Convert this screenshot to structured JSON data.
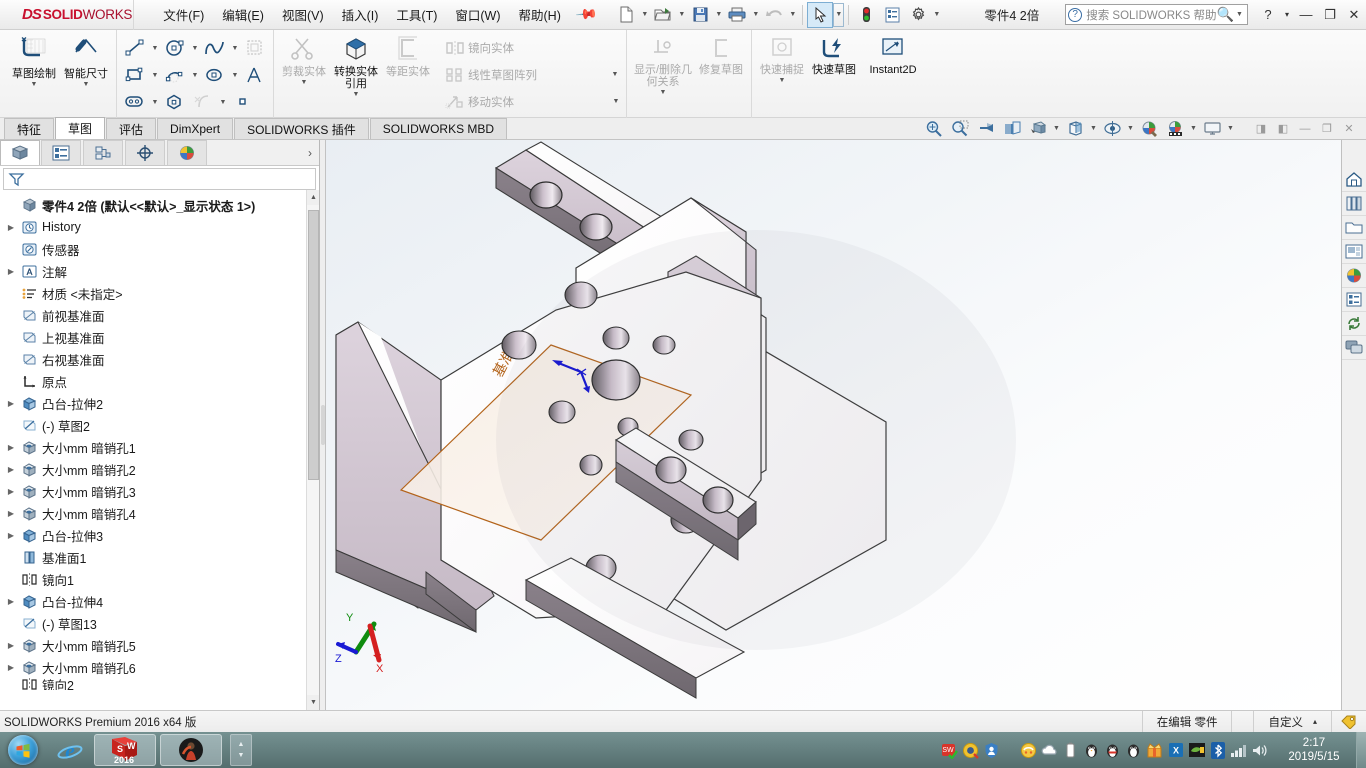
{
  "app": {
    "brand_ds": "DS",
    "brand_solid": "SOLID",
    "brand_works": "WORKS",
    "document_title": "零件4 2倍",
    "pin_icon": "pushpin-icon"
  },
  "menubar": {
    "items": [
      {
        "label": "文件(F)",
        "name": "menu-file"
      },
      {
        "label": "编辑(E)",
        "name": "menu-edit"
      },
      {
        "label": "视图(V)",
        "name": "menu-view"
      },
      {
        "label": "插入(I)",
        "name": "menu-insert"
      },
      {
        "label": "工具(T)",
        "name": "menu-tools"
      },
      {
        "label": "窗口(W)",
        "name": "menu-window"
      },
      {
        "label": "帮助(H)",
        "name": "menu-help"
      }
    ]
  },
  "quick_toolbar": {
    "buttons": [
      {
        "name": "new-document-icon",
        "has_dropdown": true
      },
      {
        "name": "open-document-icon",
        "has_dropdown": true
      },
      {
        "name": "save-icon",
        "has_dropdown": true
      },
      {
        "name": "print-icon",
        "has_dropdown": true
      },
      {
        "name": "undo-icon",
        "has_dropdown": true
      },
      {
        "name": "select-cursor-icon",
        "has_dropdown": true,
        "selected": true
      },
      {
        "name": "rebuild-icon",
        "has_dropdown": false
      },
      {
        "name": "file-properties-icon",
        "has_dropdown": false
      },
      {
        "name": "options-gear-icon",
        "has_dropdown": true
      }
    ]
  },
  "search": {
    "placeholder": "搜索 SOLIDWORKS 帮助",
    "help_icon": "question-circle-icon",
    "magnifier_icon": "search-icon"
  },
  "window_buttons": {
    "help": "?",
    "help_dropdown": "▾",
    "minimize": "—",
    "restore": "❐",
    "close": "✕"
  },
  "ribbon": {
    "group1": [
      {
        "label": "草图绘制",
        "name": "sketch-button",
        "icon": "sketch-pencil-icon",
        "enabled": true,
        "dropdown": true
      },
      {
        "label": "智能尺寸",
        "name": "smart-dimension-button",
        "icon": "smart-dimension-icon",
        "enabled": true,
        "dropdown": true
      }
    ],
    "group2_icons": [
      {
        "name": "line-tool-icon",
        "dropdown": true
      },
      {
        "name": "circle-tool-icon",
        "dropdown": true
      },
      {
        "name": "spline-tool-icon",
        "dropdown": true
      },
      {
        "name": "trim-entities-grid-icon",
        "dropdown": false
      },
      {
        "name": "rectangle-tool-icon",
        "dropdown": true
      },
      {
        "name": "arc-tool-icon",
        "dropdown": true
      },
      {
        "name": "ellipse-tool-icon",
        "dropdown": true
      },
      {
        "name": "text-tool-icon",
        "dropdown": false
      },
      {
        "name": "slot-tool-icon",
        "dropdown": true
      },
      {
        "name": "polygon-tool-icon",
        "dropdown": false
      },
      {
        "name": "fillet-tool-icon",
        "dropdown": true
      },
      {
        "name": "point-tool-icon",
        "dropdown": false
      }
    ],
    "group3": [
      {
        "label": "剪裁实体",
        "name": "trim-entities-button",
        "icon": "trim-scissors-icon",
        "enabled": false,
        "dropdown": true
      },
      {
        "label": "转换实体引用",
        "name": "convert-entities-button",
        "icon": "convert-entities-icon",
        "enabled": true,
        "dropdown": true
      },
      {
        "label": "等距实体",
        "name": "offset-entities-button",
        "icon": "offset-entities-icon",
        "enabled": false,
        "dropdown": false
      }
    ],
    "group4_rows": [
      {
        "label": "镜向实体",
        "name": "mirror-entities-button",
        "icon": "mirror-entities-icon",
        "enabled": false,
        "dropdown": false
      },
      {
        "label": "线性草图阵列",
        "name": "linear-sketch-pattern-button",
        "icon": "linear-pattern-icon",
        "enabled": false,
        "dropdown": true
      },
      {
        "label": "移动实体",
        "name": "move-entities-button",
        "icon": "move-entities-icon",
        "enabled": false,
        "dropdown": true
      }
    ],
    "group5": [
      {
        "label": "显示/删除几何关系",
        "name": "display-delete-relations-button",
        "icon": "relations-icon",
        "enabled": false,
        "dropdown": true
      },
      {
        "label": "修复草图",
        "name": "repair-sketch-button",
        "icon": "repair-sketch-icon",
        "enabled": false,
        "dropdown": false
      }
    ],
    "group6": [
      {
        "label": "快速捕捉",
        "name": "quick-snaps-button",
        "icon": "quick-snap-icon",
        "enabled": false,
        "dropdown": true
      },
      {
        "label": "快速草图",
        "name": "rapid-sketch-button",
        "icon": "rapid-sketch-icon",
        "enabled": true,
        "dropdown": false
      },
      {
        "label": "Instant2D",
        "name": "instant2d-button",
        "icon": "instant2d-icon",
        "enabled": true,
        "dropdown": false
      }
    ]
  },
  "tabs": {
    "items": [
      {
        "label": "特征",
        "name": "tab-features",
        "active": false
      },
      {
        "label": "草图",
        "name": "tab-sketch",
        "active": true
      },
      {
        "label": "评估",
        "name": "tab-evaluate",
        "active": false
      },
      {
        "label": "DimXpert",
        "name": "tab-dimxpert",
        "active": false
      },
      {
        "label": "SOLIDWORKS 插件",
        "name": "tab-solidworks-addins",
        "active": false
      },
      {
        "label": "SOLIDWORKS MBD",
        "name": "tab-solidworks-mbd",
        "active": false
      }
    ]
  },
  "view_toolbar": {
    "buttons": [
      {
        "name": "zoom-to-fit-icon",
        "dropdown": false
      },
      {
        "name": "zoom-to-area-icon",
        "dropdown": false
      },
      {
        "name": "previous-view-icon",
        "dropdown": false
      },
      {
        "name": "section-view-icon",
        "dropdown": false
      },
      {
        "name": "view-orientation-icon",
        "dropdown": false
      },
      {
        "name": "display-style-icon",
        "dropdown": true
      },
      {
        "name": "hide-show-items-icon",
        "dropdown": true
      },
      {
        "name": "edit-appearance-icon",
        "dropdown": true
      },
      {
        "name": "apply-scene-icon",
        "dropdown": true
      },
      {
        "name": "view-settings-icon",
        "dropdown": true
      }
    ],
    "window_controls": [
      {
        "name": "tile-left-icon",
        "glyph": "◨"
      },
      {
        "name": "tile-right-icon",
        "glyph": "◧"
      },
      {
        "name": "minimize-doc-icon",
        "glyph": "—"
      },
      {
        "name": "restore-doc-icon",
        "glyph": "❐"
      },
      {
        "name": "close-doc-icon",
        "glyph": "✕"
      }
    ]
  },
  "manager_tabs": [
    {
      "name": "feature-manager-tab",
      "icon": "feature-tree-icon",
      "active": true
    },
    {
      "name": "property-manager-tab",
      "icon": "property-list-icon",
      "active": false
    },
    {
      "name": "configuration-manager-tab",
      "icon": "configuration-icon",
      "active": false
    },
    {
      "name": "dimxpert-manager-tab",
      "icon": "dimxpert-target-icon",
      "active": false
    },
    {
      "name": "display-manager-tab",
      "icon": "display-sphere-icon",
      "active": false
    }
  ],
  "feature_tree": {
    "filter_icon": "filter-funnel-icon",
    "root": {
      "label": "零件4 2倍  (默认<<默认>_显示状态 1>)",
      "icon": "part-icon",
      "name": "tree-root"
    },
    "items": [
      {
        "label": "History",
        "icon": "history-icon",
        "arrow": true,
        "name": "tree-item-history"
      },
      {
        "label": "传感器",
        "icon": "sensor-icon",
        "arrow": false,
        "name": "tree-item-sensors"
      },
      {
        "label": "注解",
        "icon": "annotations-icon",
        "arrow": true,
        "name": "tree-item-annotations"
      },
      {
        "label": "材质 <未指定>",
        "icon": "material-icon",
        "arrow": false,
        "name": "tree-item-material"
      },
      {
        "label": "前视基准面",
        "icon": "plane-icon",
        "arrow": false,
        "name": "tree-item-front-plane"
      },
      {
        "label": "上视基准面",
        "icon": "plane-icon",
        "arrow": false,
        "name": "tree-item-top-plane"
      },
      {
        "label": "右视基准面",
        "icon": "plane-icon",
        "arrow": false,
        "name": "tree-item-right-plane"
      },
      {
        "label": "原点",
        "icon": "origin-icon",
        "arrow": false,
        "name": "tree-item-origin"
      },
      {
        "label": "凸台-拉伸2",
        "icon": "extrude-icon",
        "arrow": true,
        "name": "tree-item-boss-extrude2"
      },
      {
        "label": "(-) 草图2",
        "icon": "sketch-icon",
        "arrow": false,
        "name": "tree-item-sketch2"
      },
      {
        "label": "大小mm 暗销孔1",
        "icon": "hole-wizard-icon",
        "arrow": true,
        "name": "tree-item-dowel-hole1"
      },
      {
        "label": "大小mm 暗销孔2",
        "icon": "hole-wizard-icon",
        "arrow": true,
        "name": "tree-item-dowel-hole2"
      },
      {
        "label": "大小mm 暗销孔3",
        "icon": "hole-wizard-icon",
        "arrow": true,
        "name": "tree-item-dowel-hole3"
      },
      {
        "label": "大小mm 暗销孔4",
        "icon": "hole-wizard-icon",
        "arrow": true,
        "name": "tree-item-dowel-hole4"
      },
      {
        "label": "凸台-拉伸3",
        "icon": "extrude-icon",
        "arrow": true,
        "name": "tree-item-boss-extrude3"
      },
      {
        "label": "基准面1",
        "icon": "reference-plane-icon",
        "arrow": false,
        "name": "tree-item-plane1"
      },
      {
        "label": "镜向1",
        "icon": "mirror-icon",
        "arrow": false,
        "name": "tree-item-mirror1"
      },
      {
        "label": "凸台-拉伸4",
        "icon": "extrude-icon",
        "arrow": true,
        "name": "tree-item-boss-extrude4"
      },
      {
        "label": "(-) 草图13",
        "icon": "sketch-icon",
        "arrow": false,
        "name": "tree-item-sketch13"
      },
      {
        "label": "大小mm 暗销孔5",
        "icon": "hole-wizard-icon",
        "arrow": true,
        "name": "tree-item-dowel-hole5"
      },
      {
        "label": "大小mm 暗销孔6",
        "icon": "hole-wizard-icon",
        "arrow": true,
        "name": "tree-item-dowel-hole6"
      },
      {
        "label": "镜向2",
        "icon": "mirror-icon",
        "arrow": false,
        "name": "tree-item-mirror2"
      }
    ]
  },
  "graphics": {
    "plane_label": "基准面1",
    "triad": {
      "x": "X",
      "y": "Y",
      "z": "Z",
      "x_color": "#d42020",
      "y_color": "#0f8c0f",
      "z_color": "#1a1ad4"
    },
    "plane_border_color": "#b3631a",
    "model_face_light": "#ffffff",
    "model_face_side": "#cfc4cf",
    "model_face_dark": "#7a727a"
  },
  "taskpane": [
    {
      "name": "task-pane-home-icon"
    },
    {
      "name": "design-library-icon"
    },
    {
      "name": "file-explorer-icon"
    },
    {
      "name": "view-palette-icon"
    },
    {
      "name": "appearances-scenes-icon"
    },
    {
      "name": "custom-properties-icon"
    },
    {
      "name": "sync-icon"
    },
    {
      "name": "forum-icon"
    }
  ],
  "statusbar": {
    "version": "SOLIDWORKS Premium 2016 x64 版",
    "edit_state": "在编辑 零件",
    "customize": "自定义",
    "customize_arrow": "▴",
    "tag_icon": "tag-icon"
  },
  "taskbar": {
    "start_name": "start-orb",
    "items": [
      {
        "name": "taskbar-internet-explorer",
        "type": "pinned"
      },
      {
        "name": "taskbar-solidworks-2016",
        "type": "window",
        "label": "2016"
      },
      {
        "name": "taskbar-media-window",
        "type": "window"
      }
    ],
    "tray": [
      {
        "name": "tray-solidworks-icon"
      },
      {
        "name": "tray-update-icon"
      },
      {
        "name": "tray-security-shield-icon"
      },
      {
        "name": "tray-safe-icon"
      },
      {
        "name": "tray-cloud-icon"
      },
      {
        "name": "tray-battery-icon"
      },
      {
        "name": "tray-qq-penguin-icon"
      },
      {
        "name": "tray-qq-penguin-scarf-icon"
      },
      {
        "name": "tray-qq-penguin-2-icon"
      },
      {
        "name": "tray-gift-icon"
      },
      {
        "name": "tray-wps-icon"
      },
      {
        "name": "tray-nvidia-icon"
      },
      {
        "name": "tray-bluetooth-icon"
      },
      {
        "name": "tray-network-icon"
      },
      {
        "name": "tray-volume-icon"
      }
    ],
    "clock": {
      "time": "2:17",
      "date": "2019/5/15"
    }
  }
}
